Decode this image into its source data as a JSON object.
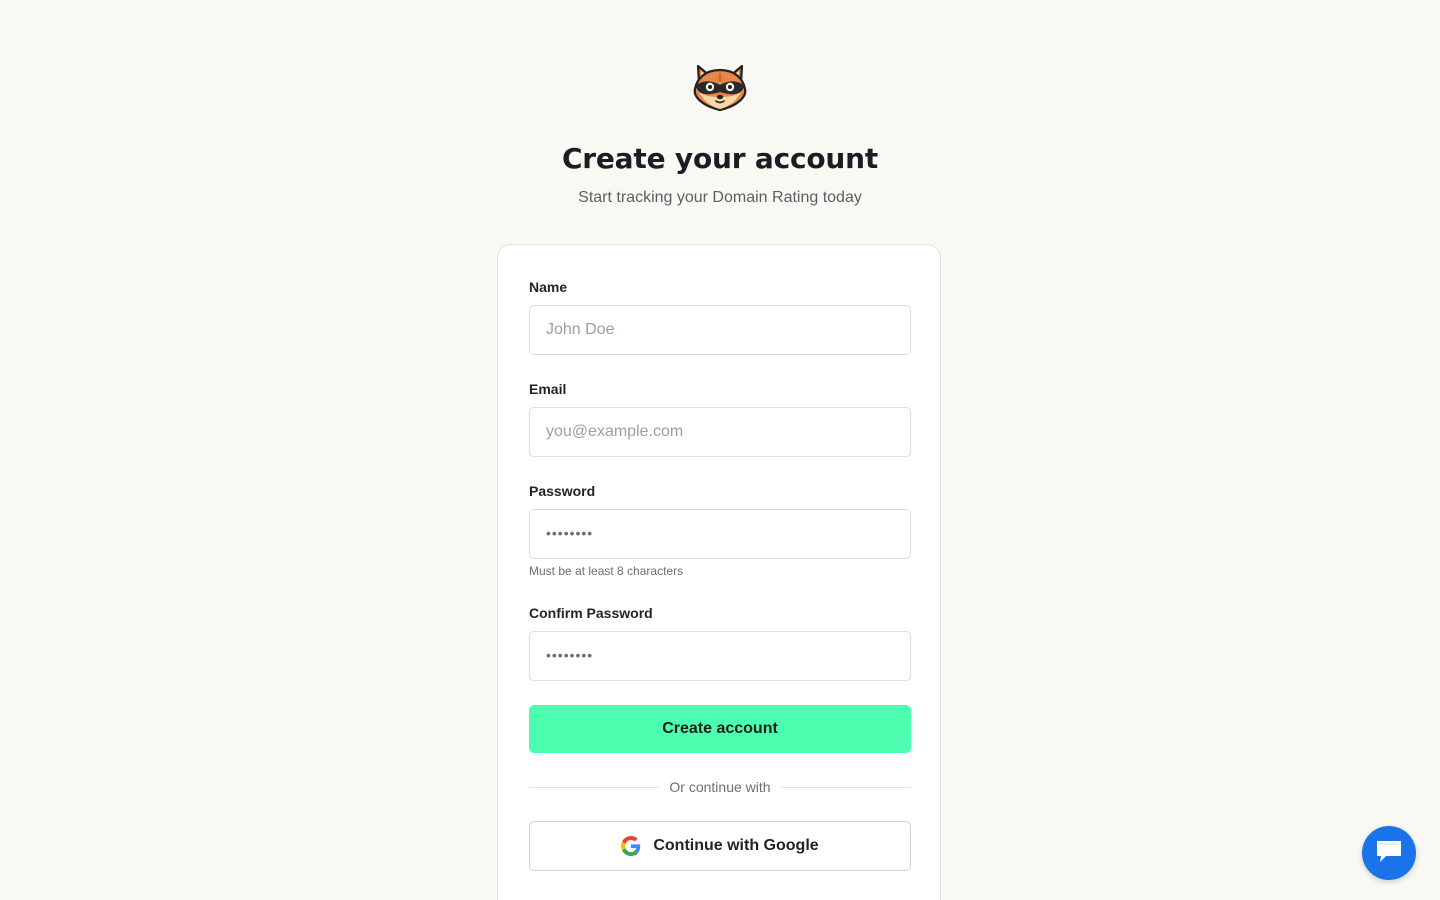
{
  "header": {
    "title": "Create your account",
    "subtitle": "Start tracking your Domain Rating today",
    "logo_icon": "raccoon-logo-icon"
  },
  "form": {
    "name": {
      "label": "Name",
      "placeholder": "John Doe",
      "value": ""
    },
    "email": {
      "label": "Email",
      "placeholder": "you@example.com",
      "value": ""
    },
    "password": {
      "label": "Password",
      "placeholder": "••••••••",
      "value": "",
      "hint": "Must be at least 8 characters"
    },
    "confirm_password": {
      "label": "Confirm Password",
      "placeholder": "••••••••",
      "value": ""
    },
    "submit_label": "Create account",
    "divider_text": "Or continue with",
    "google_label": "Continue with Google"
  },
  "chat": {
    "icon": "chat-bubble-icon"
  },
  "colors": {
    "background": "#faf8f3",
    "primary_button": "#4dfdb0",
    "chat_button": "#1a73e8"
  }
}
